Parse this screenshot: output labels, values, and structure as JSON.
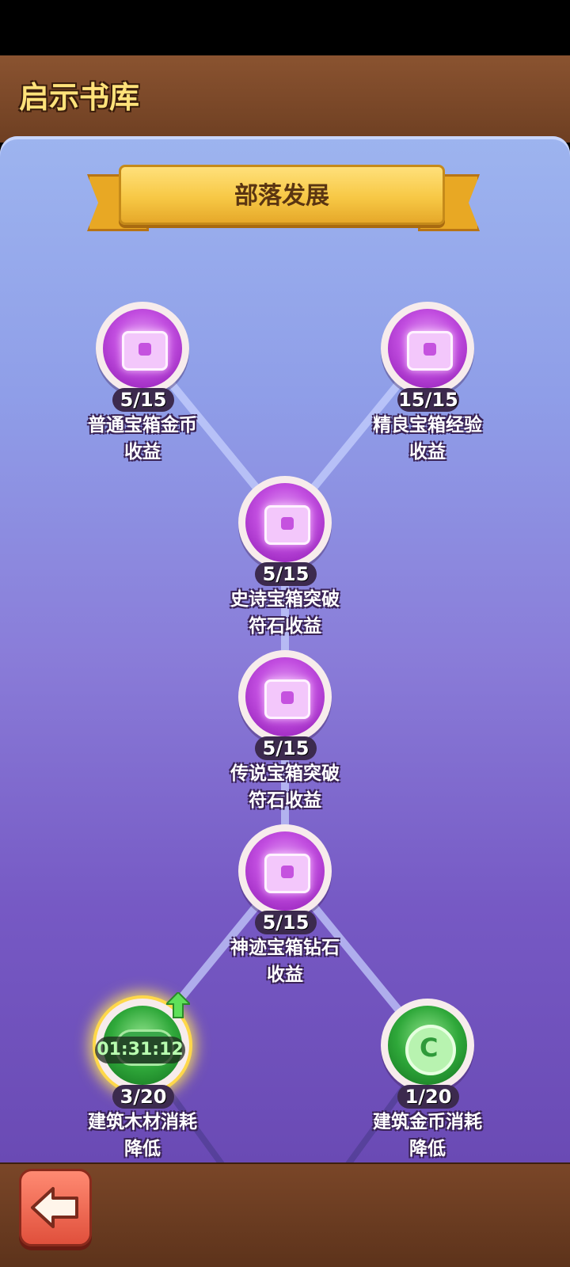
{
  "header": {
    "title": "启示书库"
  },
  "section": {
    "title": "部落发展"
  },
  "nodes": [
    {
      "count": "5/15",
      "label_line1": "普通宝箱金币",
      "label_line2": "收益"
    },
    {
      "count": "15/15",
      "label_line1": "精良宝箱经验",
      "label_line2": "收益"
    },
    {
      "count": "5/15",
      "label_line1": "史诗宝箱突破",
      "label_line2": "符石收益"
    },
    {
      "count": "5/15",
      "label_line1": "传说宝箱突破",
      "label_line2": "符石收益"
    },
    {
      "count": "5/15",
      "label_line1": "神迹宝箱钻石",
      "label_line2": "收益"
    },
    {
      "count": "3/20",
      "label_line1": "建筑木材消耗",
      "label_line2": "降低",
      "timer": "01:31:12"
    },
    {
      "count": "1/20",
      "label_line1": "建筑金币消耗",
      "label_line2": "降低"
    }
  ],
  "icons": {
    "back": "back-arrow-icon",
    "upgrade": "upgrade-arrow-icon",
    "chest": "treasure-chest-icon",
    "coin": "coin-icon",
    "log": "wood-log-icon"
  },
  "colors": {
    "header_bg": "#7a4628",
    "title_yellow": "#ffe27a",
    "ribbon": "#f7c845",
    "purple_node": "#c24ee0",
    "green_node": "#2fa83a"
  }
}
